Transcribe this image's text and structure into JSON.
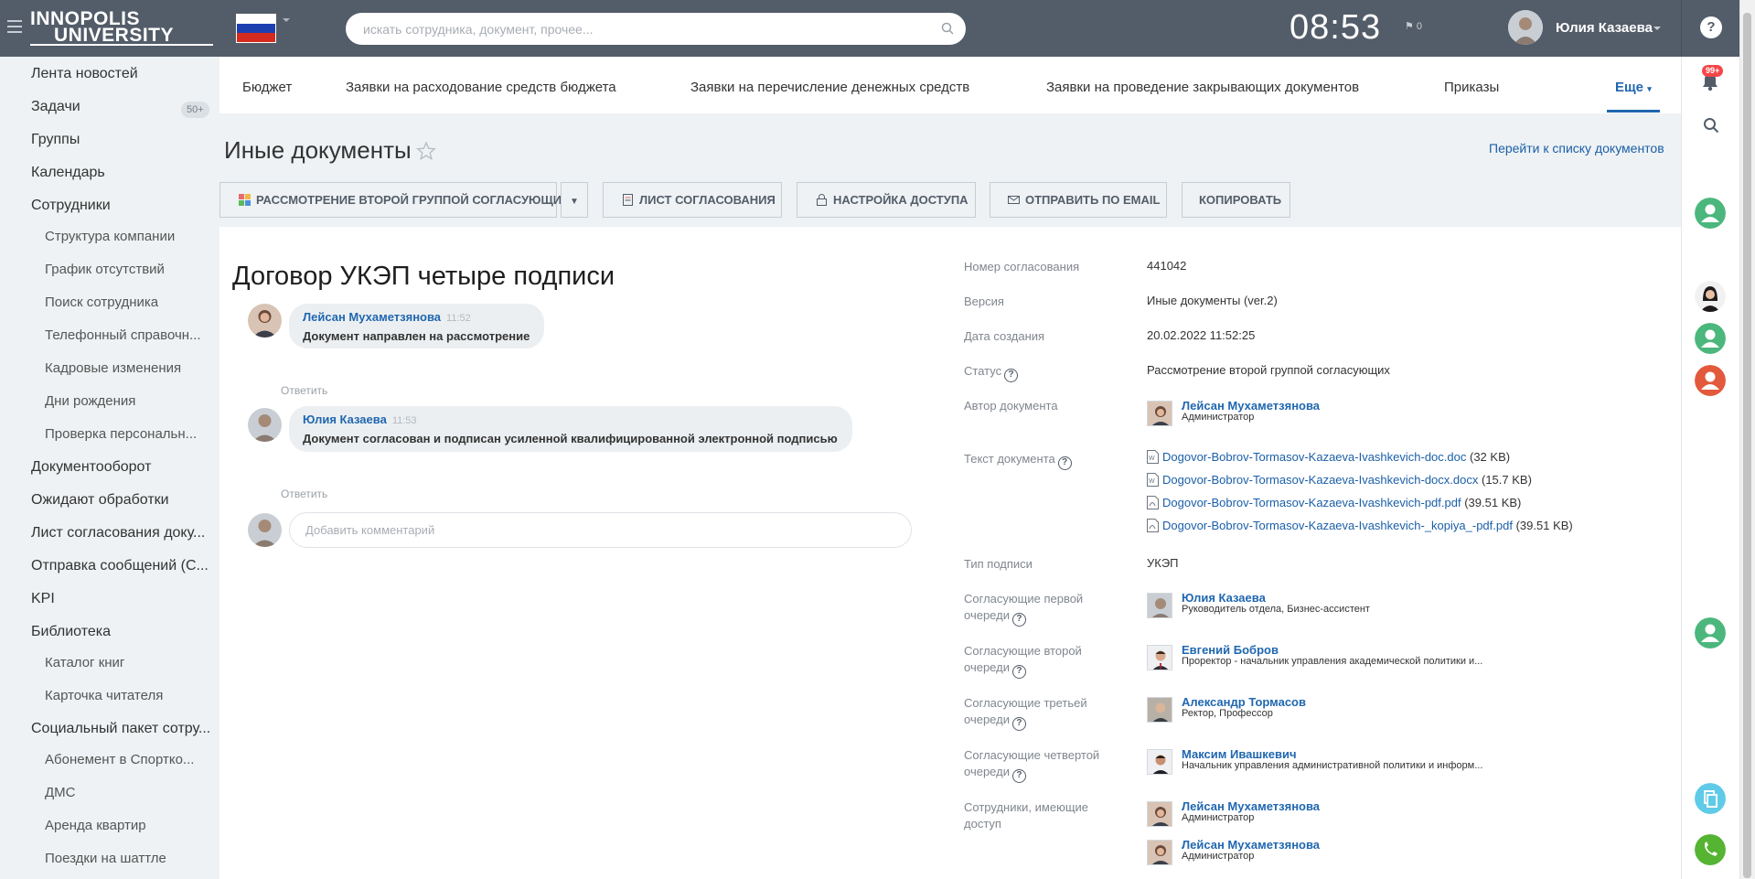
{
  "header": {
    "logo_line1": "INNOPOLIS",
    "logo_line2": "UNIVERSITY",
    "search_placeholder": "искать сотрудника, документ, прочее...",
    "clock": "08:53",
    "flag_count": "0",
    "user_name": "Юлия Казаева",
    "help": "?"
  },
  "menu": {
    "items": [
      "Лента новостей",
      "Задачи",
      "Группы",
      "Календарь",
      "Сотрудники",
      "Документооборот",
      "Ожидают обработки",
      "Лист согласования доку...",
      "Отправка сообщений (С...",
      "KPI",
      "Библиотека",
      "Социальный пакет сотру..."
    ],
    "tasks_badge": "50+",
    "sub_employees": [
      "Структура компании",
      "График отсутствий",
      "Поиск сотрудника",
      "Телефонный справочн...",
      "Кадровые изменения",
      "Дни рождения",
      "Проверка персональн..."
    ],
    "sub_library": [
      "Каталог книг",
      "Карточка читателя"
    ],
    "sub_social": [
      "Абонемент в Спортко...",
      "ДМС",
      "Аренда квартир",
      "Поездки на шаттле"
    ]
  },
  "tabs": [
    "Бюджет",
    "Заявки на расходование средств бюджета",
    "Заявки на перечисление денежных средств",
    "Заявки на проведение закрывающих документов",
    "Приказы",
    "Еще"
  ],
  "page": {
    "title": "Иные документы",
    "goto_link": "Перейти к списку документов"
  },
  "toolbar": {
    "review": "Рассмотрение второй группой согласующих",
    "approval_sheet": "Лист согласования",
    "access": "Настройка доступа",
    "email": "Отправить по email",
    "copy": "Копировать"
  },
  "document": {
    "title": "Договор УКЭП четыре подписи"
  },
  "comments": [
    {
      "author": "Лейсан Мухаметзянова",
      "time": "11:52",
      "text": "Документ направлен на рассмотрение"
    },
    {
      "author": "Юлия Казаева",
      "time": "11:53",
      "text": "Документ согласован и подписан усиленной квалифицированной электронной подписью"
    }
  ],
  "reply_label": "Ответить",
  "add_comment_placeholder": "Добавить комментарий",
  "props": {
    "number_label": "Номер согласования",
    "number": "441042",
    "version_label": "Версия",
    "version": "Иные документы (ver.2)",
    "created_label": "Дата создания",
    "created": "20.02.2022 11:52:25",
    "status_label": "Статус",
    "status": "Рассмотрение второй группой согласующих",
    "author_label": "Автор документа",
    "author": {
      "name": "Лейсан Мухаметзянова",
      "role": "Администратор"
    },
    "text_label": "Текст документа",
    "files": [
      {
        "name": "Dogovor-Bobrov-Tormasov-Kazaeva-Ivashkevich-doc.doc",
        "size": "(32 KB)"
      },
      {
        "name": "Dogovor-Bobrov-Tormasov-Kazaeva-Ivashkevich-docx.docx",
        "size": "(15.7 KB)"
      },
      {
        "name": "Dogovor-Bobrov-Tormasov-Kazaeva-Ivashkevich-pdf.pdf",
        "size": "(39.51 KB)"
      },
      {
        "name": "Dogovor-Bobrov-Tormasov-Kazaeva-Ivashkevich-_kopiya_-pdf.pdf",
        "size": "(39.51 KB)"
      }
    ],
    "sign_label": "Тип подписи",
    "sign": "УКЭП",
    "q1_label_a": "Согласующие первой",
    "q1_label_b": "очереди",
    "q1": {
      "name": "Юлия Казаева",
      "role": "Руководитель отдела, Бизнес-ассистент"
    },
    "q2_label_a": "Согласующие второй",
    "q2_label_b": "очереди",
    "q2": {
      "name": "Евгений Бобров",
      "role": "Проректор - начальник управления академической политики и..."
    },
    "q3_label_a": "Согласующие третьей",
    "q3_label_b": "очереди",
    "q3": {
      "name": "Александр Тормасов",
      "role": "Ректор, Профессор"
    },
    "q4_label_a": "Согласующие четвертой",
    "q4_label_b": "очереди",
    "q4": {
      "name": "Максим Ивашкевич",
      "role": "Начальник управления административной политики и информ..."
    },
    "access_label_a": "Сотрудники, имеющие",
    "access_label_b": "доступ",
    "access_people": [
      {
        "name": "Лейсан Мухаметзянова",
        "role": "Администратор"
      },
      {
        "name": "Лейсан Мухаметзянова",
        "role": "Администратор"
      }
    ]
  },
  "rail": {
    "notif_badge": "99+"
  },
  "colors": {
    "header": "#535c69",
    "link": "#2067b0",
    "accent_green": "#2fc6a0",
    "green_avatar": "#4bb77c",
    "red_avatar": "#e3593b"
  }
}
